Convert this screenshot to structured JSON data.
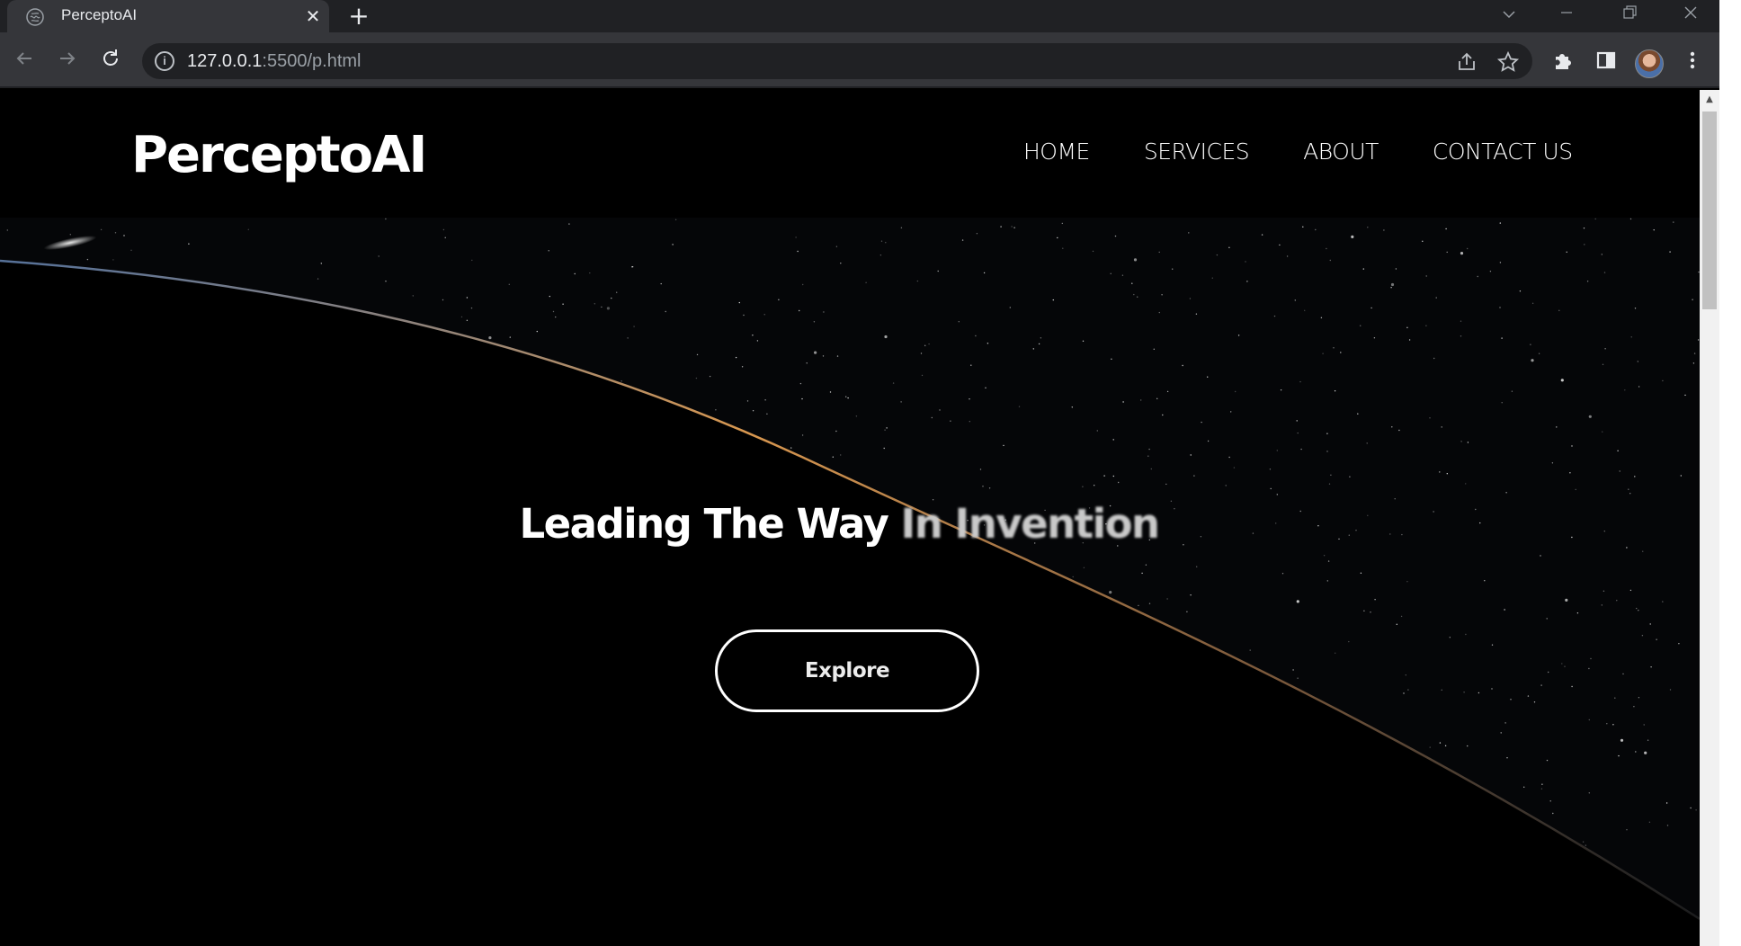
{
  "browser": {
    "tab_title": "PerceptoAI",
    "tab_close_glyph": "✕",
    "new_tab_glyph": "+",
    "url_host": "127.0.0.1",
    "url_rest": ":5500/p.html"
  },
  "site": {
    "logo": "PerceptoAI",
    "nav": {
      "home": "HOME",
      "services": "SERVICES",
      "about": "ABOUT",
      "contact": "CONTACT US"
    }
  },
  "hero": {
    "title_main": "Leading The Way",
    "title_accent": "In Invention",
    "button_label": "Explore"
  },
  "colors": {
    "page_bg": "#000000",
    "chrome_dark": "#202124",
    "chrome_tab": "#35363a",
    "horizon_glow": "#e0a050"
  }
}
